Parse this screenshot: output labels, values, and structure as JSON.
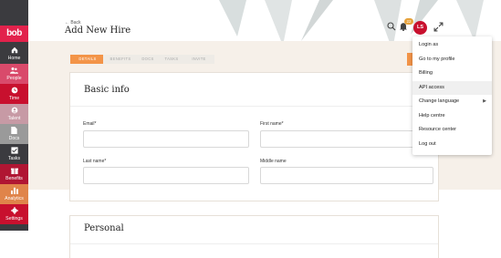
{
  "app": {
    "logo_text": "bob"
  },
  "sidebar": {
    "items": [
      {
        "label": "Home",
        "icon": "home-icon",
        "color": "#3b3b3f"
      },
      {
        "label": "People",
        "icon": "people-icon",
        "color": "#d94a6b"
      },
      {
        "label": "Time",
        "icon": "time-icon",
        "color": "#c8102e"
      },
      {
        "label": "Talent",
        "icon": "talent-icon",
        "color": "#c79aa5"
      },
      {
        "label": "Docs",
        "icon": "docs-icon",
        "color": "#9a9a9a"
      },
      {
        "label": "Tasks",
        "icon": "tasks-icon",
        "color": "#3b3b3f"
      },
      {
        "label": "Benefits",
        "icon": "benefits-icon",
        "color": "#b01633"
      },
      {
        "label": "Analytics",
        "icon": "analytics-icon",
        "color": "#e0844a"
      },
      {
        "label": "Settings",
        "icon": "settings-icon",
        "color": "#c8102e"
      }
    ]
  },
  "header": {
    "back_label": "← Back",
    "title": "Add New Hire",
    "notification_count": "22",
    "avatar_initials": "LS"
  },
  "steps": [
    {
      "label": "DETAILS",
      "active": true
    },
    {
      "label": "BENEFITS",
      "active": false
    },
    {
      "label": "DOCS",
      "active": false
    },
    {
      "label": "TASKS",
      "active": false
    },
    {
      "label": "INVITE",
      "active": false
    }
  ],
  "basic_info": {
    "title": "Basic info",
    "email_label": "Email*",
    "first_name_label": "First name*",
    "last_name_label": "Last name*",
    "middle_name_label": "Middle name"
  },
  "personal": {
    "title": "Personal"
  },
  "user_menu": {
    "items": [
      {
        "label": "Login as"
      },
      {
        "label": "Go to my profile"
      },
      {
        "label": "Billing"
      },
      {
        "label": "API access"
      },
      {
        "label": "Change language"
      },
      {
        "label": "Help centre"
      },
      {
        "label": "Resource center"
      },
      {
        "label": "Log out"
      }
    ]
  },
  "colors": {
    "brand": "#e2224c",
    "accent": "#f39448",
    "sidebar": "#3b3b3f",
    "content_bg": "#f6f0e9"
  }
}
